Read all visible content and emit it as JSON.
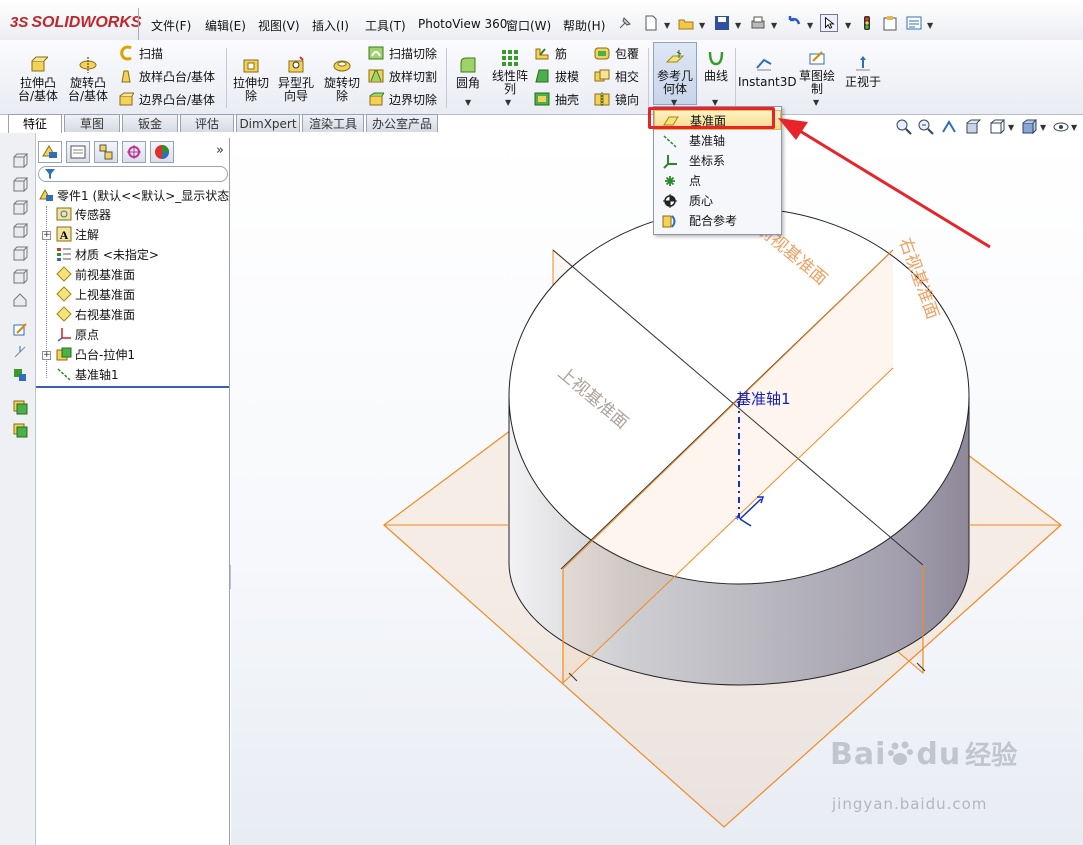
{
  "app": {
    "logo_prefix": "3S",
    "logo_text": "SOLIDWORKS"
  },
  "menu": {
    "items": [
      "文件(F)",
      "编辑(E)",
      "视图(V)",
      "插入(I)",
      "工具(T)",
      "PhotoView 360",
      "窗口(W)",
      "帮助(H)"
    ]
  },
  "toolbar": {
    "extrude_boss": "拉伸凸\n台/基体",
    "revolve_boss": "旋转凸\n台/基体",
    "sweep": "扫描",
    "loft_boss": "放样凸台/基体",
    "boundary_boss": "边界凸台/基体",
    "extrude_cut": "拉伸切\n除",
    "hole_wizard": "异型孔\n向导",
    "revolve_cut": "旋转切\n除",
    "swept_cut": "扫描切除",
    "lofted_cut": "放样切割",
    "boundary_cut": "边界切除",
    "fillet": "圆角",
    "linear_pattern": "线性阵\n列",
    "rib": "筋",
    "draft": "拔模",
    "shell": "抽壳",
    "wrap": "包覆",
    "intersect": "相交",
    "mirror": "镜向",
    "reference_geometry": "参考几\n何体",
    "curves": "曲线",
    "instant3d": "Instant3D",
    "sketch": "草图绘\n制",
    "normal_to": "正视于"
  },
  "tabs": [
    "特征",
    "草图",
    "钣金",
    "评估",
    "DimXpert",
    "渲染工具",
    "办公室产品"
  ],
  "tree": {
    "root": "零件1 (默认<<默认>_显示状态",
    "items": [
      "传感器",
      "注解",
      "材质 <未指定>",
      "前视基准面",
      "上视基准面",
      "右视基准面",
      "原点",
      "凸台-拉伸1",
      "基准轴1"
    ]
  },
  "dropdown": {
    "items": [
      "基准面",
      "基准轴",
      "坐标系",
      "点",
      "质心",
      "配合参考"
    ]
  },
  "viewport": {
    "axis_label": "基准轴1",
    "front_plane_label": "前视基准面",
    "top_plane_label": "上视基准面",
    "right_plane_label": "右视基准面"
  },
  "watermark": {
    "brand": "Bai",
    "brand_tail": "du",
    "cn": "经验",
    "url": "jingyan.baidu.com"
  },
  "colors": {
    "plane_orange": "#f08a24",
    "highlight_red": "#e8232a",
    "axis_blue": "#1030d0"
  }
}
